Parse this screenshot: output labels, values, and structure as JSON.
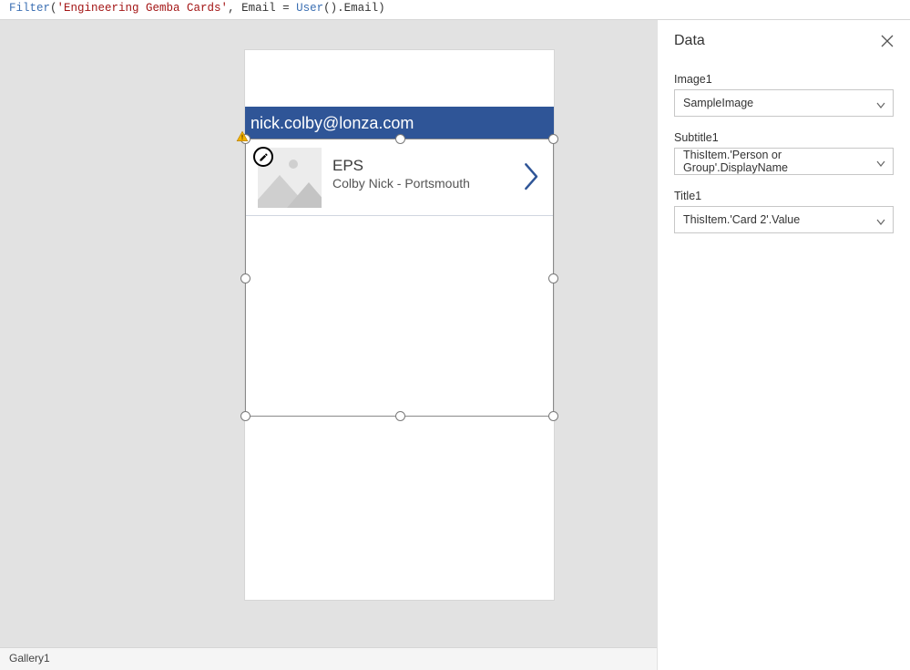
{
  "formula": {
    "fn": "Filter",
    "lp": "(",
    "arg1": "'Engineering Gemba Cards'",
    "comma": ", ",
    "field": "Email",
    "eq": " = ",
    "userfn": "User",
    "userparens": "().",
    "emailprop": "Email",
    "rp": ")"
  },
  "header": {
    "email": "nick.colby@lonza.com"
  },
  "gallery": {
    "item": {
      "title": "EPS",
      "subtitle": "Colby Nick - Portsmouth"
    }
  },
  "panel": {
    "title": "Data",
    "fields": {
      "image1_label": "Image1",
      "image1_value": "SampleImage",
      "subtitle1_label": "Subtitle1",
      "subtitle1_value": "ThisItem.'Person or Group'.DisplayName",
      "title1_label": "Title1",
      "title1_value": "ThisItem.'Card 2'.Value"
    }
  },
  "status": {
    "selected": "Gallery1"
  }
}
